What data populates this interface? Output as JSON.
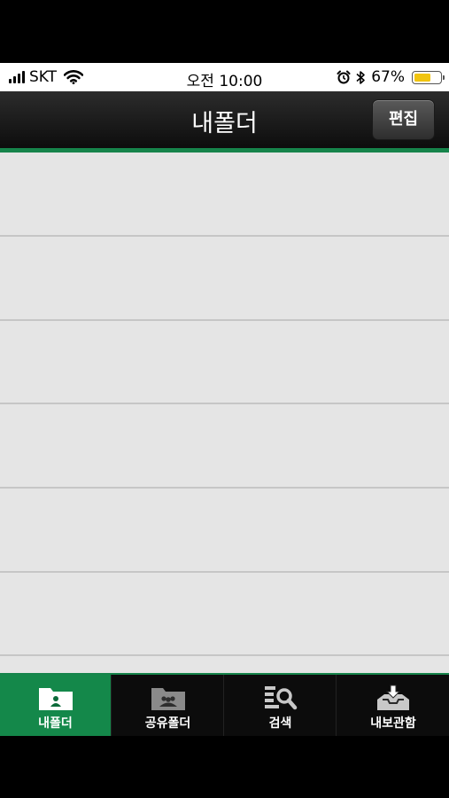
{
  "status": {
    "carrier": "SKT",
    "time": "오전 10:00",
    "battery_pct": "67%",
    "battery_level": 0.67,
    "battery_color": "#f1c40f"
  },
  "header": {
    "title": "내폴더",
    "edit_label": "편집"
  },
  "tabs": [
    {
      "label": "내폴더",
      "icon": "my-folder-icon",
      "active": true
    },
    {
      "label": "공유폴더",
      "icon": "shared-folder-icon",
      "active": false
    },
    {
      "label": "검색",
      "icon": "search-icon",
      "active": false
    },
    {
      "label": "내보관함",
      "icon": "inbox-download-icon",
      "active": false
    }
  ],
  "colors": {
    "accent": "#16844b",
    "list_background": "#e5e5e5"
  }
}
